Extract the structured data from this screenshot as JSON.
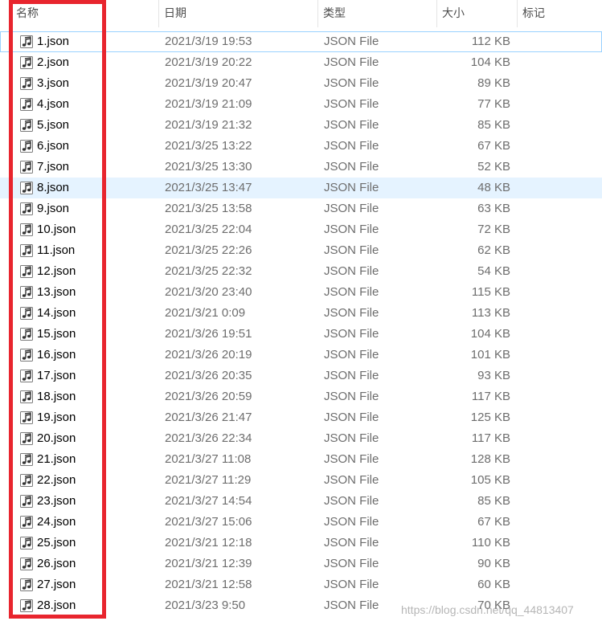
{
  "columns": {
    "name": "名称",
    "date": "日期",
    "type": "类型",
    "size": "大小",
    "tag": "标记"
  },
  "sort_indicator": "^",
  "files": [
    {
      "name": "1.json",
      "date": "2021/3/19 19:53",
      "type": "JSON File",
      "size": "112 KB"
    },
    {
      "name": "2.json",
      "date": "2021/3/19 20:22",
      "type": "JSON File",
      "size": "104 KB"
    },
    {
      "name": "3.json",
      "date": "2021/3/19 20:47",
      "type": "JSON File",
      "size": "89 KB"
    },
    {
      "name": "4.json",
      "date": "2021/3/19 21:09",
      "type": "JSON File",
      "size": "77 KB"
    },
    {
      "name": "5.json",
      "date": "2021/3/19 21:32",
      "type": "JSON File",
      "size": "85 KB"
    },
    {
      "name": "6.json",
      "date": "2021/3/25 13:22",
      "type": "JSON File",
      "size": "67 KB"
    },
    {
      "name": "7.json",
      "date": "2021/3/25 13:30",
      "type": "JSON File",
      "size": "52 KB"
    },
    {
      "name": "8.json",
      "date": "2021/3/25 13:47",
      "type": "JSON File",
      "size": "48 KB"
    },
    {
      "name": "9.json",
      "date": "2021/3/25 13:58",
      "type": "JSON File",
      "size": "63 KB"
    },
    {
      "name": "10.json",
      "date": "2021/3/25 22:04",
      "type": "JSON File",
      "size": "72 KB"
    },
    {
      "name": "11.json",
      "date": "2021/3/25 22:26",
      "type": "JSON File",
      "size": "62 KB"
    },
    {
      "name": "12.json",
      "date": "2021/3/25 22:32",
      "type": "JSON File",
      "size": "54 KB"
    },
    {
      "name": "13.json",
      "date": "2021/3/20 23:40",
      "type": "JSON File",
      "size": "115 KB"
    },
    {
      "name": "14.json",
      "date": "2021/3/21 0:09",
      "type": "JSON File",
      "size": "113 KB"
    },
    {
      "name": "15.json",
      "date": "2021/3/26 19:51",
      "type": "JSON File",
      "size": "104 KB"
    },
    {
      "name": "16.json",
      "date": "2021/3/26 20:19",
      "type": "JSON File",
      "size": "101 KB"
    },
    {
      "name": "17.json",
      "date": "2021/3/26 20:35",
      "type": "JSON File",
      "size": "93 KB"
    },
    {
      "name": "18.json",
      "date": "2021/3/26 20:59",
      "type": "JSON File",
      "size": "117 KB"
    },
    {
      "name": "19.json",
      "date": "2021/3/26 21:47",
      "type": "JSON File",
      "size": "125 KB"
    },
    {
      "name": "20.json",
      "date": "2021/3/26 22:34",
      "type": "JSON File",
      "size": "117 KB"
    },
    {
      "name": "21.json",
      "date": "2021/3/27 11:08",
      "type": "JSON File",
      "size": "128 KB"
    },
    {
      "name": "22.json",
      "date": "2021/3/27 11:29",
      "type": "JSON File",
      "size": "105 KB"
    },
    {
      "name": "23.json",
      "date": "2021/3/27 14:54",
      "type": "JSON File",
      "size": "85 KB"
    },
    {
      "name": "24.json",
      "date": "2021/3/27 15:06",
      "type": "JSON File",
      "size": "67 KB"
    },
    {
      "name": "25.json",
      "date": "2021/3/21 12:18",
      "type": "JSON File",
      "size": "110 KB"
    },
    {
      "name": "26.json",
      "date": "2021/3/21 12:39",
      "type": "JSON File",
      "size": "90 KB"
    },
    {
      "name": "27.json",
      "date": "2021/3/21 12:58",
      "type": "JSON File",
      "size": "60 KB"
    },
    {
      "name": "28.json",
      "date": "2021/3/23 9:50",
      "type": "JSON File",
      "size": "70 KB"
    }
  ],
  "file_icon": "music-note-file-icon",
  "watermark": "https://blog.csdn.net/qq_44813407",
  "colors": {
    "highlight_border": "#e8252e",
    "hover_row": "#e5f3ff",
    "focus_outline": "#99d1ff"
  }
}
